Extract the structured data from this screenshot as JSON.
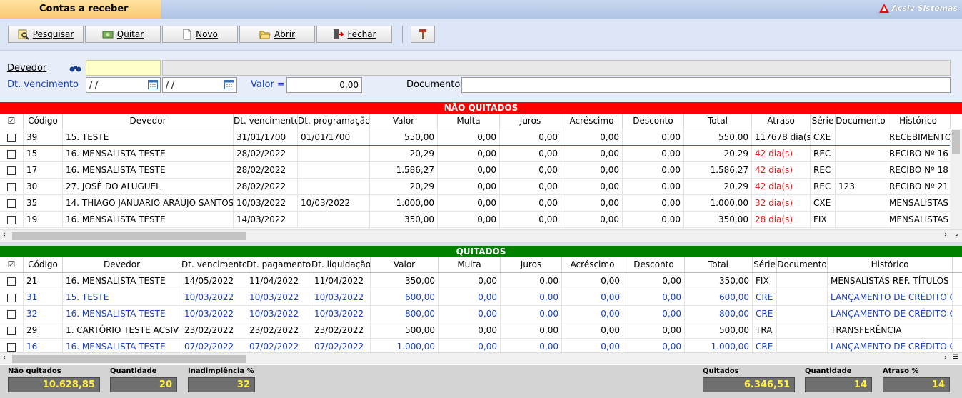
{
  "window": {
    "title": "Contas a receber",
    "brand": "Acsiv Sistemas"
  },
  "toolbar": {
    "pesquisar": "Pesquisar",
    "quitar": "Quitar",
    "novo": "Novo",
    "abrir": "Abrir",
    "fechar": "Fechar"
  },
  "filters": {
    "devedor_label": "Devedor",
    "devedor_value": "",
    "devedor_name": "",
    "dt_label": "Dt. vencimento",
    "dt_from": " /  /",
    "dt_to": " /  /",
    "valor_label": "Valor =",
    "valor_value": "0,00",
    "documento_label": "Documento",
    "documento_value": ""
  },
  "nao_quitados": {
    "title": "NÃO QUITADOS",
    "headers": [
      "☑",
      "Código",
      "Devedor",
      "Dt. vencimento",
      "Dt. programação",
      "Valor",
      "Multa",
      "Juros",
      "Acréscimo",
      "Desconto",
      "Total",
      "Atraso",
      "Série",
      "Documento",
      "Histórico"
    ],
    "rows": [
      [
        "",
        "39",
        "15. TESTE",
        "31/01/1700",
        "01/01/1700",
        "550,00",
        "0,00",
        "0,00",
        "0,00",
        "0,00",
        "550,00",
        "117678 dia(s)",
        "CXE",
        "",
        "RECEBIMENTO"
      ],
      [
        "",
        "15",
        "16. MENSALISTA TESTE",
        "28/02/2022",
        "",
        "20,29",
        "0,00",
        "0,00",
        "0,00",
        "0,00",
        "20,29",
        "42 dia(s)",
        "REC",
        "",
        "RECIBO Nº 16"
      ],
      [
        "",
        "17",
        "16. MENSALISTA TESTE",
        "28/02/2022",
        "",
        "1.586,27",
        "0,00",
        "0,00",
        "0,00",
        "0,00",
        "1.586,27",
        "42 dia(s)",
        "REC",
        "",
        "RECIBO Nº 18"
      ],
      [
        "",
        "30",
        "27. JOSÉ DO ALUGUEL",
        "28/02/2022",
        "",
        "20,29",
        "0,00",
        "0,00",
        "0,00",
        "0,00",
        "20,29",
        "42 dia(s)",
        "REC",
        "123",
        "RECIBO Nº 21"
      ],
      [
        "",
        "35",
        "14. THIAGO JANUARIO ARAUJO SANTOS",
        "10/03/2022",
        "10/03/2022",
        "1.000,00",
        "0,00",
        "0,00",
        "0,00",
        "0,00",
        "1.000,00",
        "32 dia(s)",
        "CXE",
        "",
        "MENSALISTAS"
      ],
      [
        "",
        "19",
        "16. MENSALISTA TESTE",
        "14/03/2022",
        "",
        "350,00",
        "0,00",
        "0,00",
        "0,00",
        "0,00",
        "350,00",
        "28 dia(s)",
        "FIX",
        "",
        "MENSALISTAS"
      ]
    ]
  },
  "quitados": {
    "title": "QUITADOS",
    "headers": [
      "☑",
      "Código",
      "Devedor",
      "Dt. vencimento",
      "Dt. pagamento",
      "Dt. liquidação",
      "Valor",
      "Multa",
      "Juros",
      "Acréscimo",
      "Desconto",
      "Total",
      "Série",
      "Documento",
      "Histórico"
    ],
    "rows": [
      [
        "",
        "21",
        "16. MENSALISTA TESTE",
        "14/05/2022",
        "11/04/2022",
        "11/04/2022",
        "350,00",
        "0,00",
        "0,00",
        "0,00",
        "0,00",
        "350,00",
        "FIX",
        "",
        "MENSALISTAS REF. TÍTULOS"
      ],
      [
        "",
        "31",
        "15. TESTE",
        "10/03/2022",
        "10/03/2022",
        "10/03/2022",
        "600,00",
        "0,00",
        "0,00",
        "0,00",
        "0,00",
        "600,00",
        "CRE",
        "",
        "LANÇAMENTO DE CRÉDITO C"
      ],
      [
        "",
        "32",
        "16. MENSALISTA TESTE",
        "10/03/2022",
        "10/03/2022",
        "10/03/2022",
        "800,00",
        "0,00",
        "0,00",
        "0,00",
        "0,00",
        "800,00",
        "CRE",
        "",
        "LANÇAMENTO DE CRÉDITO C"
      ],
      [
        "",
        "29",
        "1. CARTÓRIO TESTE ACSIV",
        "23/02/2022",
        "23/02/2022",
        "23/02/2022",
        "500,00",
        "0,00",
        "0,00",
        "0,00",
        "0,00",
        "500,00",
        "TRA",
        "",
        "TRANSFERÊNCIA"
      ],
      [
        "",
        "16",
        "16. MENSALISTA TESTE",
        "07/02/2022",
        "07/02/2022",
        "07/02/2022",
        "1.000,00",
        "0,00",
        "0,00",
        "0,00",
        "0,00",
        "1.000,00",
        "CRE",
        "",
        "LANÇAMENTO DE CRÉDITO C"
      ]
    ]
  },
  "footer": {
    "nao_quitados_label": "Não quitados",
    "nao_quitados_value": "10.628,85",
    "quantidade_label": "Quantidade",
    "quantidade_value": "20",
    "inadimplencia_label": "Inadimplência %",
    "inadimplencia_value": "32",
    "quitados_label": "Quitados",
    "quitados_value": "6.346,51",
    "quantidade2_label": "Quantidade",
    "quantidade2_value": "14",
    "atraso_label": "Atraso %",
    "atraso_value": "14"
  },
  "colors": {
    "nao_quitados_bar": "#ff0000",
    "quitados_bar": "#008000",
    "late_text": "#e02020",
    "credit_text": "#1a3fbf",
    "footer_value": "#ffef40"
  }
}
